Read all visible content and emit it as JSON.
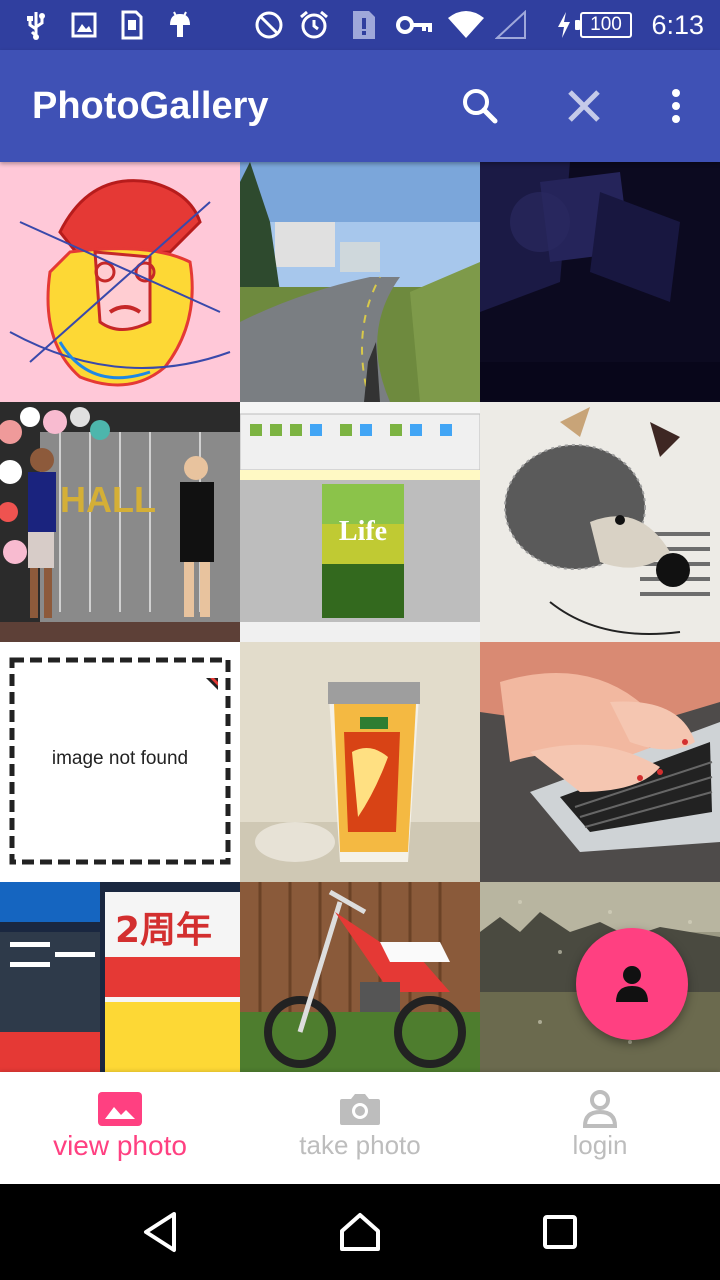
{
  "status_bar": {
    "time": "6:13",
    "battery": "100",
    "icons": [
      "usb-icon",
      "image-notification-icon",
      "sim-icon",
      "android-icon",
      "do-not-disturb-icon",
      "alarm-icon",
      "sim-alert-icon",
      "vpn-key-icon",
      "wifi-icon",
      "cell-signal-icon",
      "charging-icon"
    ]
  },
  "app_bar": {
    "title": "PhotoGallery",
    "actions": [
      "search-icon",
      "close-icon",
      "more-vert-icon"
    ]
  },
  "photos": [
    {
      "name": "sketch-portrait"
    },
    {
      "name": "road-path"
    },
    {
      "name": "dark-room"
    },
    {
      "name": "party-photo"
    },
    {
      "name": "pdf-editor-screenshot",
      "caption": "Life"
    },
    {
      "name": "crochet-hedgehog"
    },
    {
      "name": "image-not-found",
      "caption": "image not found"
    },
    {
      "name": "noodle-cup"
    },
    {
      "name": "laptop-typing"
    },
    {
      "name": "shop-sign",
      "caption": "2周年"
    },
    {
      "name": "dirt-bike"
    },
    {
      "name": "rainy-window"
    }
  ],
  "fab": {
    "icon": "person-icon"
  },
  "bottom_nav": {
    "items": [
      {
        "label": "view photo",
        "icon": "image-icon",
        "active": true
      },
      {
        "label": "take photo",
        "icon": "camera-icon",
        "active": false
      },
      {
        "label": "login",
        "icon": "person-outline-icon",
        "active": false
      }
    ]
  },
  "colors": {
    "status_bar": "#303F9F",
    "app_bar": "#3F51B5",
    "accent": "#FF4081",
    "inactive": "#BDBDBD"
  }
}
